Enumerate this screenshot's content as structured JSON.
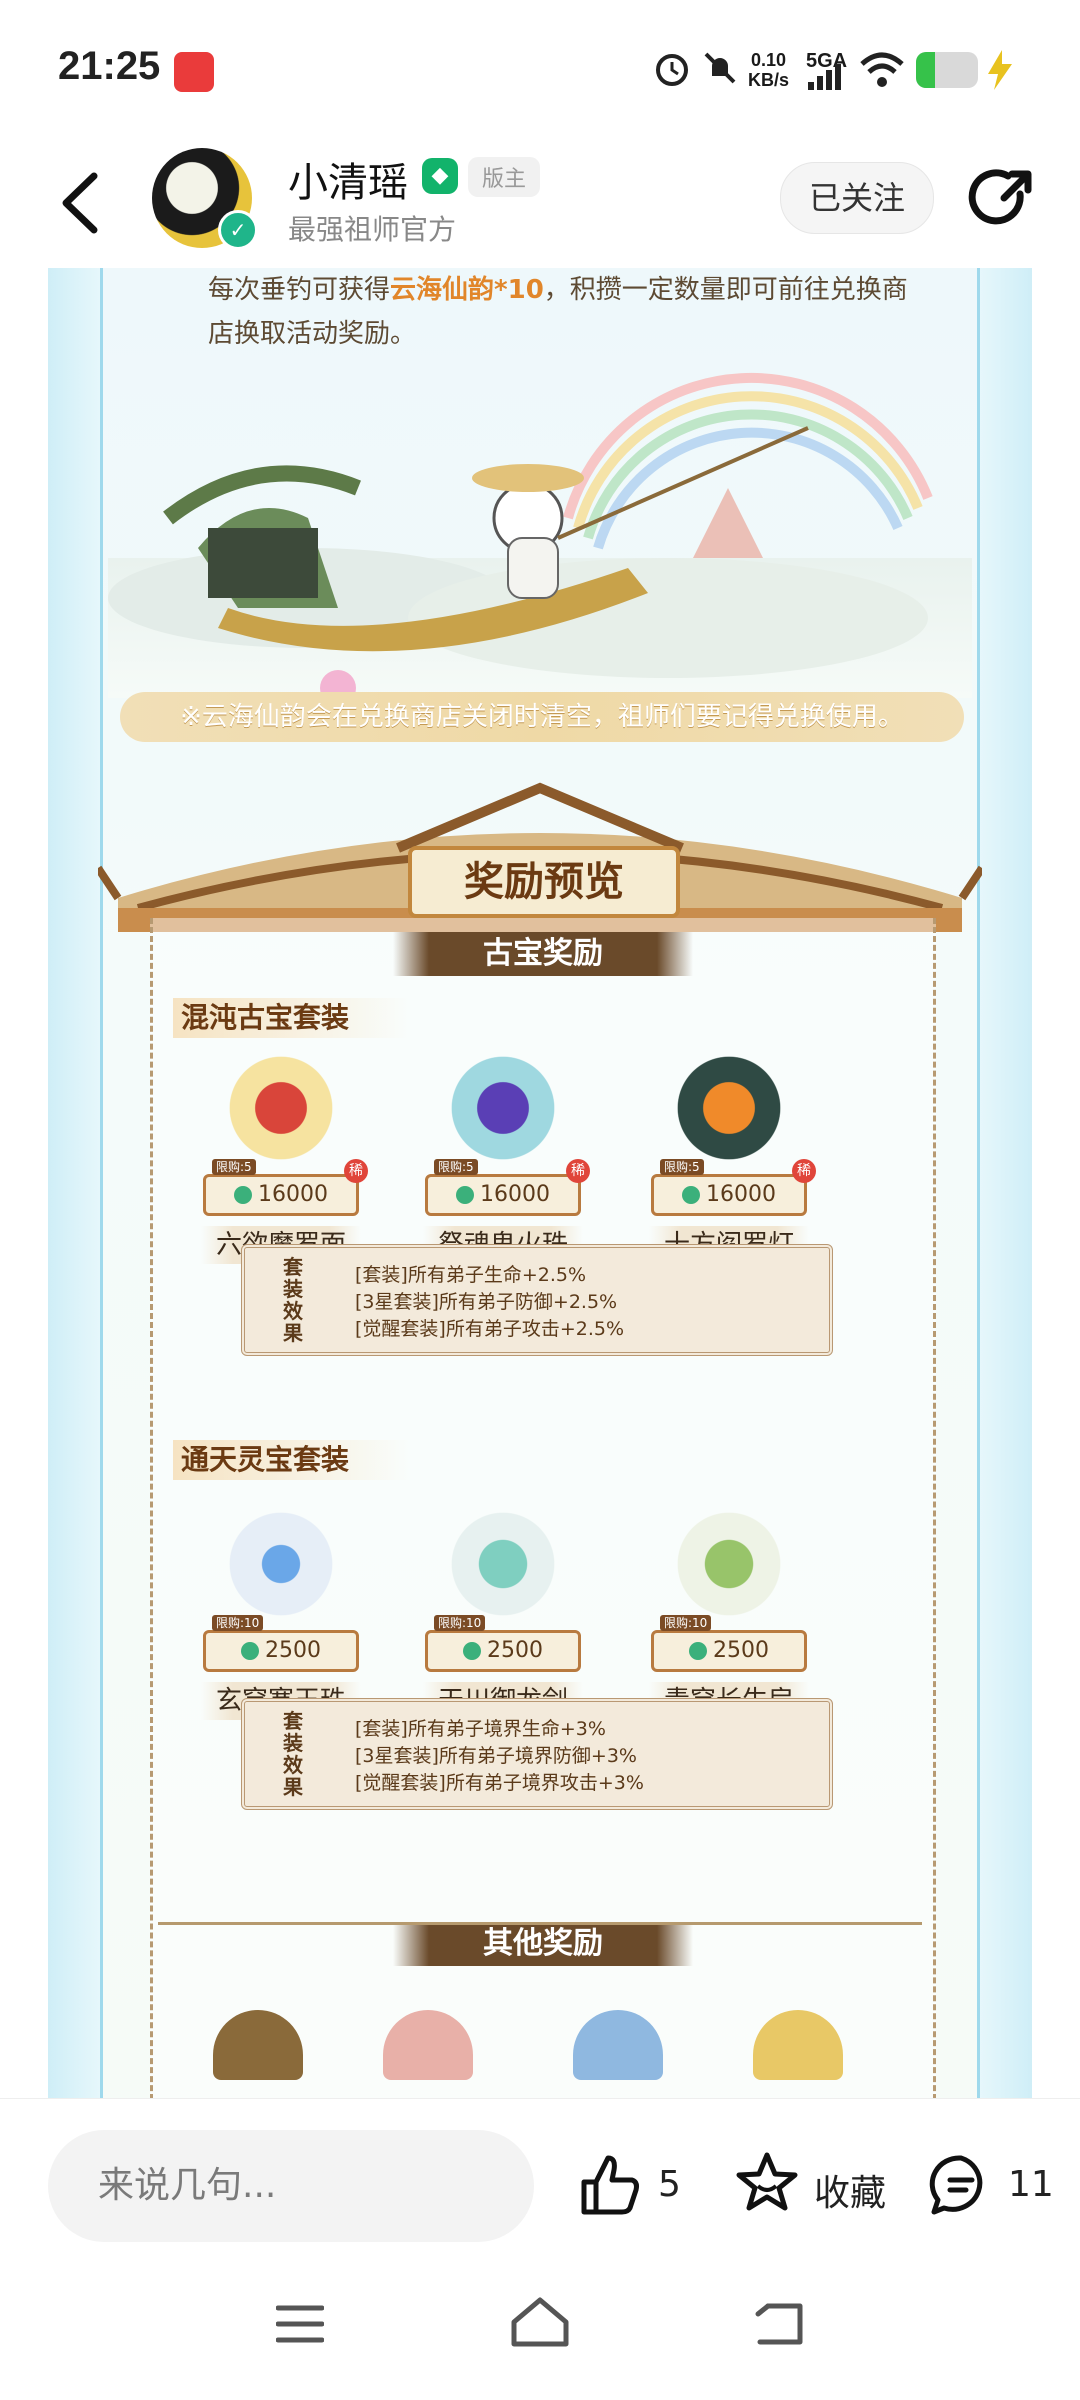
{
  "status_bar": {
    "time": "21:25",
    "net_speed": [
      "0.10",
      "KB/s"
    ],
    "network": "5GA",
    "battery_level": 0.3,
    "icons": [
      "alarm-icon",
      "mute-icon",
      "signal-icon",
      "wifi-icon",
      "battery-icon",
      "charging-icon"
    ]
  },
  "header": {
    "author_name": "小清瑶",
    "role_tag": "版主",
    "subtitle": "最强祖师官方",
    "follow_label": "已关注"
  },
  "post": {
    "intro_prefix": "每次垂钓可获得",
    "intro_highlight": "云海仙韵*10",
    "intro_suffix": "，积攒一定数量即可前往兑换商店换取活动奖励。",
    "notice": "※云海仙韵会在兑换商店关闭时清空，祖师们要记得兑换使用。",
    "reward_title": "奖励预览",
    "ancient_banner": "古宝奖励",
    "set1": {
      "title": "混沌古宝套装",
      "limit": "限购:5",
      "badge": "稀",
      "items": [
        {
          "name": "六欲魔罗面",
          "price": "16000"
        },
        {
          "name": "祭魂鬼火珠",
          "price": "16000"
        },
        {
          "name": "十方阎罗灯",
          "price": "16000"
        }
      ],
      "effect_label": "套装效果",
      "effects": [
        "[套装]所有弟子生命+2.5%",
        "[3星套装]所有弟子防御+2.5%",
        "[觉醒套装]所有弟子攻击+2.5%"
      ]
    },
    "set2": {
      "title": "通天灵宝套装",
      "limit": "限购:10",
      "items": [
        {
          "name": "玄穹寒玉珠",
          "price": "2500"
        },
        {
          "name": "天川御龙剑",
          "price": "2500"
        },
        {
          "name": "青穹长生扇",
          "price": "2500"
        }
      ],
      "effect_label": "套装效果",
      "effects": [
        "[套装]所有弟子境界生命+3%",
        "[3星套装]所有弟子境界防御+3%",
        "[觉醒套装]所有弟子境界攻击+3%"
      ]
    },
    "other_banner": "其他奖励"
  },
  "bottom_bar": {
    "comment_placeholder": "来说几句...",
    "likes": "5",
    "favorite_label": "收藏",
    "comments": "11"
  },
  "colors": {
    "accent_green": "#12b36b",
    "highlight_orange": "#e1862a",
    "frame_brown": "#b87a3f"
  }
}
